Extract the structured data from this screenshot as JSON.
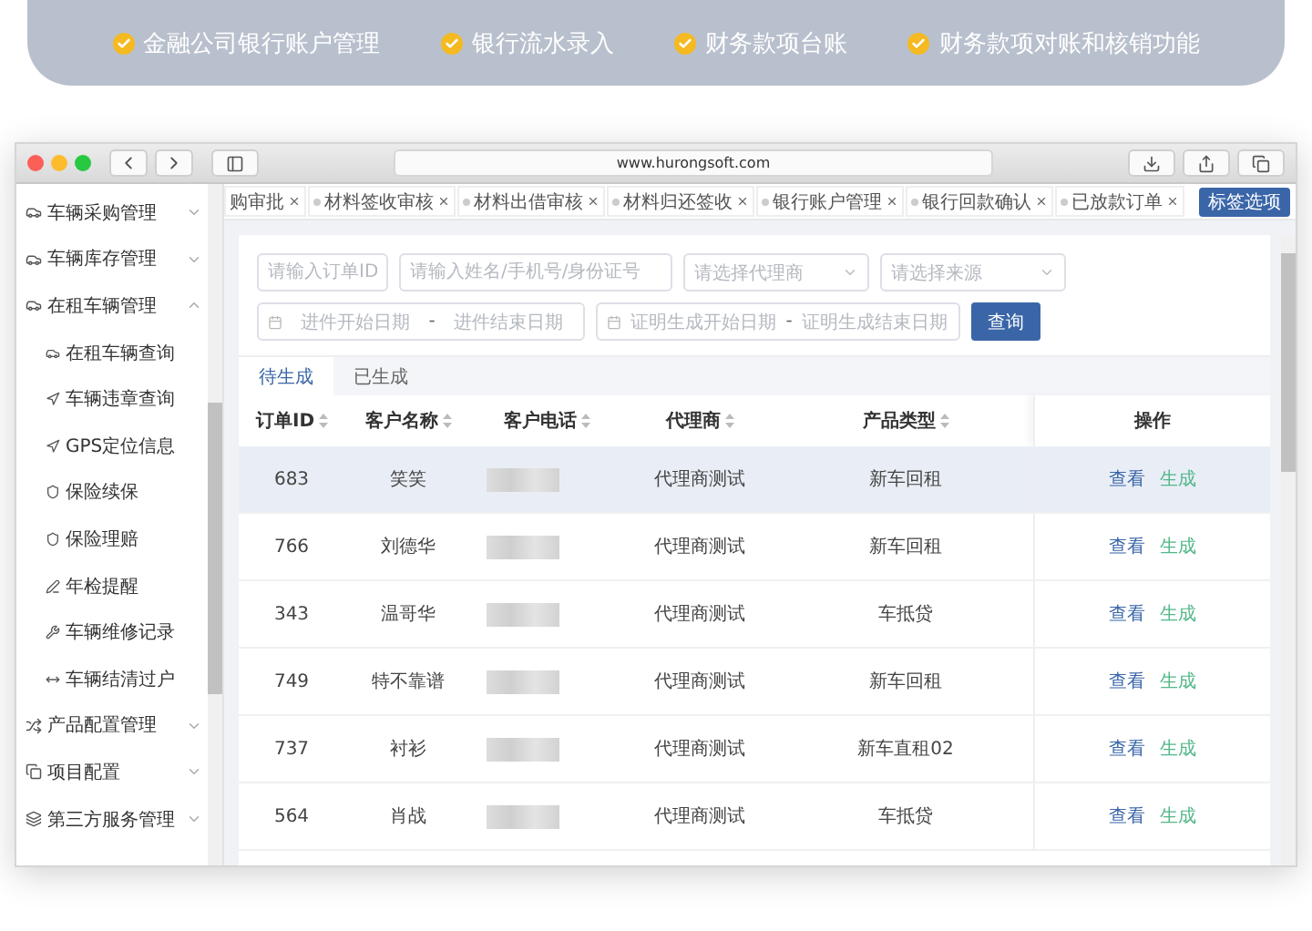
{
  "banner": {
    "items": [
      {
        "label": "金融公司银行账户管理"
      },
      {
        "label": "银行流水录入"
      },
      {
        "label": "财务款项台账"
      },
      {
        "label": "财务款项对账和核销功能"
      }
    ]
  },
  "browser": {
    "url": "www.hurongsoft.com"
  },
  "sidebar": {
    "items": [
      {
        "label": "车辆采购管理",
        "expanded": false
      },
      {
        "label": "车辆库存管理",
        "expanded": false
      },
      {
        "label": "在租车辆管理",
        "expanded": true,
        "children": [
          {
            "label": "在租车辆查询"
          },
          {
            "label": "车辆违章查询"
          },
          {
            "label": "GPS定位信息"
          },
          {
            "label": "保险续保"
          },
          {
            "label": "保险理赔"
          },
          {
            "label": "年检提醒"
          },
          {
            "label": "车辆维修记录"
          },
          {
            "label": "车辆结清过户"
          }
        ]
      },
      {
        "label": "产品配置管理",
        "expanded": false
      },
      {
        "label": "项目配置",
        "expanded": false
      },
      {
        "label": "第三方服务管理",
        "expanded": false
      }
    ]
  },
  "open_tabs": [
    {
      "label": "购审批",
      "dot": false
    },
    {
      "label": "材料签收审核",
      "dot": true
    },
    {
      "label": "材料出借审核",
      "dot": true
    },
    {
      "label": "材料归还签收",
      "dot": true
    },
    {
      "label": "银行账户管理",
      "dot": true
    },
    {
      "label": "银行回款确认",
      "dot": true
    },
    {
      "label": "已放款订单",
      "dot": true
    }
  ],
  "tab_options_button": "标签选项",
  "filters": {
    "fields": [
      {
        "kind": "input",
        "placeholder": "请输入订单ID"
      },
      {
        "kind": "input",
        "placeholder": "请输入姓名/手机号/身份证号"
      },
      {
        "kind": "select",
        "placeholder": "请选择代理商"
      },
      {
        "kind": "select",
        "placeholder": "请选择来源"
      }
    ],
    "date_ranges": [
      {
        "start": "进件开始日期",
        "separator": "-",
        "end": "进件结束日期"
      },
      {
        "start": "证明生成开始日期",
        "separator": "-",
        "end": "证明生成结束日期"
      }
    ],
    "search_button": "查询"
  },
  "status_tabs": [
    {
      "label": "待生成",
      "selected": true
    },
    {
      "label": "已生成",
      "selected": false
    }
  ],
  "table": {
    "columns": [
      "订单ID",
      "客户名称",
      "客户电话",
      "代理商",
      "产品类型",
      "操作"
    ],
    "rows": [
      {
        "id": "683",
        "name": "笑笑",
        "agent": "代理商测试",
        "product": "新车回租",
        "view": "查看",
        "generate": "生成",
        "selected": true
      },
      {
        "id": "766",
        "name": "刘德华",
        "agent": "代理商测试",
        "product": "新车回租",
        "view": "查看",
        "generate": "生成",
        "selected": false
      },
      {
        "id": "343",
        "name": "温哥华",
        "agent": "代理商测试",
        "product": "车抵贷",
        "view": "查看",
        "generate": "生成",
        "selected": false
      },
      {
        "id": "749",
        "name": "特不靠谱",
        "agent": "代理商测试",
        "product": "新车回租",
        "view": "查看",
        "generate": "生成",
        "selected": false
      },
      {
        "id": "737",
        "name": "衬衫",
        "agent": "代理商测试",
        "product": "新车直租02",
        "view": "查看",
        "generate": "生成",
        "selected": false
      },
      {
        "id": "564",
        "name": "肖战",
        "agent": "代理商测试",
        "product": "车抵贷",
        "view": "查看",
        "generate": "生成",
        "selected": false
      }
    ]
  }
}
